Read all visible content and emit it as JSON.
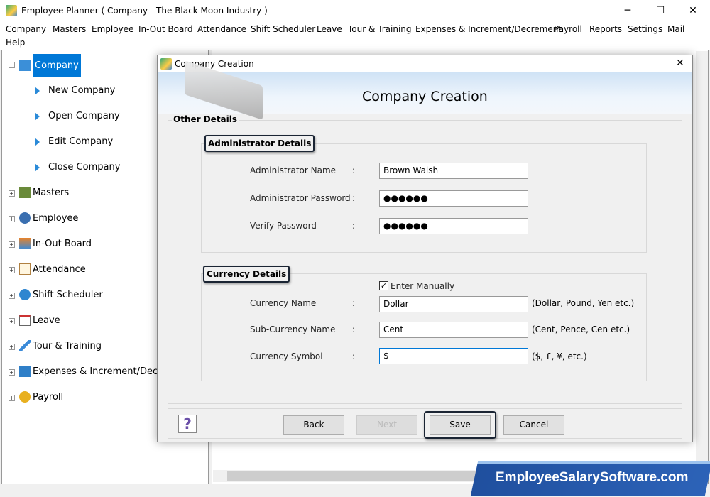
{
  "window": {
    "title": "Employee Planner ( Company - The Black Moon Industry )",
    "minimize": "─",
    "maximize": "☐",
    "close": "✕"
  },
  "menu": [
    "Company",
    "Masters",
    "Employee",
    "In-Out Board",
    "Attendance",
    "Shift Scheduler",
    "Leave",
    "Tour & Training",
    "Expenses & Increment/Decrement",
    "Payroll",
    "Reports",
    "Settings",
    "Mail",
    "Help"
  ],
  "tree": {
    "root": "Company",
    "children": [
      "New Company",
      "Open Company",
      "Edit Company",
      "Close Company"
    ],
    "items": [
      "Masters",
      "Employee",
      "In-Out Board",
      "Attendance",
      "Shift Scheduler",
      "Leave",
      "Tour & Training",
      "Expenses & Increment/Decrement",
      "Payroll"
    ],
    "selected_color": "#0078d7"
  },
  "dialog": {
    "title": "Company Creation",
    "heading": "Company Creation",
    "close": "✕",
    "group_title": "Other Details",
    "admin": {
      "legend": "Administrator Details",
      "fields": [
        {
          "label": "Administrator Name",
          "value": "Brown Walsh"
        },
        {
          "label": "Administrator Password",
          "value": "●●●●●●"
        },
        {
          "label": "Verify Password",
          "value": "●●●●●●"
        }
      ]
    },
    "currency": {
      "legend": "Currency Details",
      "checkbox_label": "Enter Manually",
      "checkbox_checked": true,
      "fields": [
        {
          "label": "Currency Name",
          "value": "Dollar",
          "hint": "(Dollar, Pound, Yen etc.)"
        },
        {
          "label": "Sub-Currency Name",
          "value": "Cent",
          "hint": "(Cent, Pence, Cen etc.)"
        },
        {
          "label": "Currency Symbol",
          "value": "$",
          "hint": "($, £, ¥, etc.)"
        }
      ]
    },
    "colon": ":",
    "buttons": {
      "help": "?",
      "back": "Back",
      "next": "Next",
      "save": "Save",
      "cancel": "Cancel"
    }
  },
  "watermark": "EmployeeSalarySoftware.com"
}
